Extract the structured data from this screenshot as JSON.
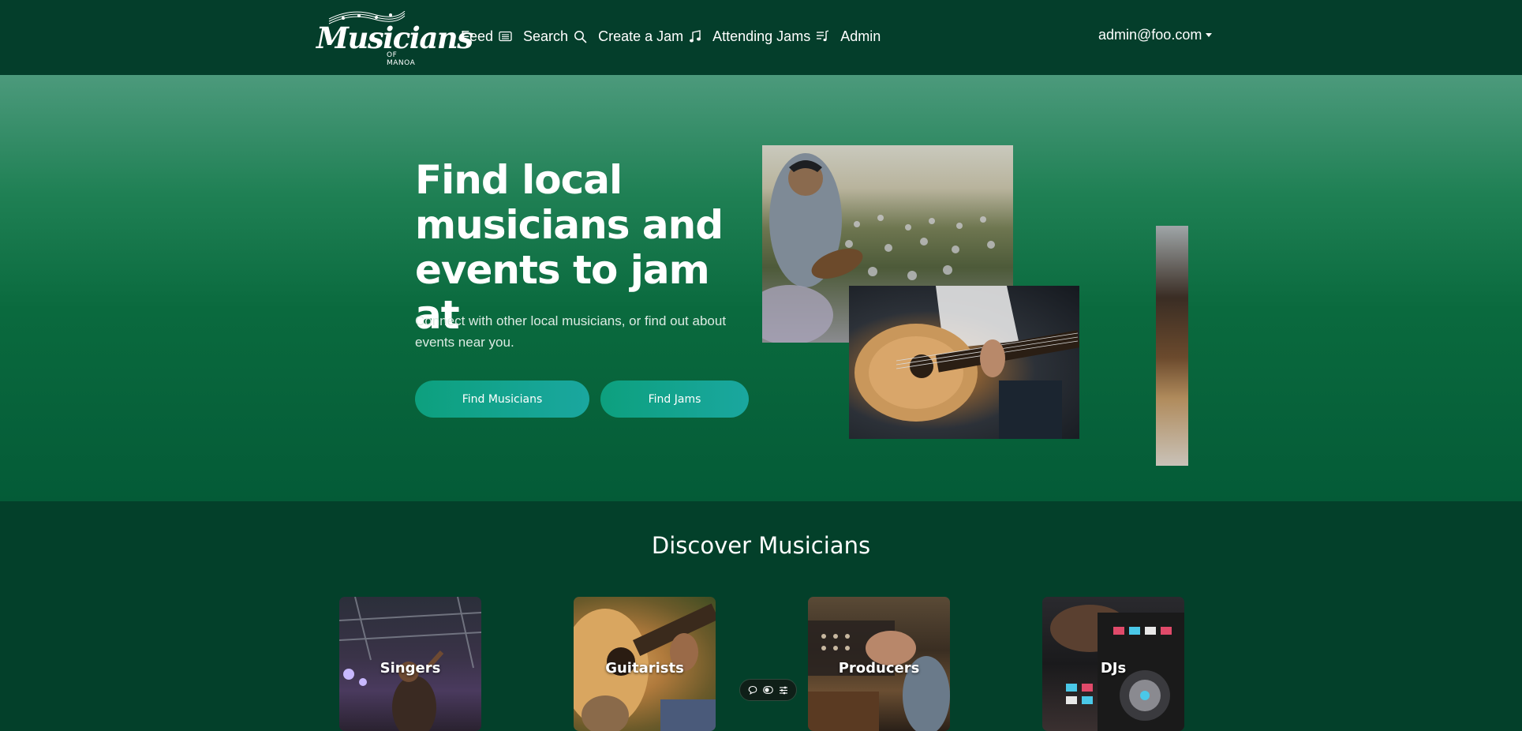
{
  "app": {
    "logo_text": "Musicians",
    "logo_subtext": "OF MANOA"
  },
  "nav": {
    "items": [
      {
        "label": "Feed",
        "icon": "feed-icon"
      },
      {
        "label": "Search",
        "icon": "search-icon"
      },
      {
        "label": "Create a Jam",
        "icon": "music-note-icon"
      },
      {
        "label": "Attending Jams",
        "icon": "playlist-icon"
      },
      {
        "label": "Admin",
        "icon": ""
      }
    ],
    "user_email": "admin@foo.com"
  },
  "hero": {
    "title": "Find local musicians and events to jam at",
    "subtitle": "Connect with other local musicians, or find out about events near you.",
    "buttons": {
      "find_musicians": "Find Musicians",
      "find_jams": "Find Jams"
    }
  },
  "discover": {
    "title": "Discover Musicians",
    "cards": [
      {
        "label": "Singers"
      },
      {
        "label": "Guitarists"
      },
      {
        "label": "Producers"
      },
      {
        "label": "DJs"
      }
    ]
  },
  "floating_toolbar": {
    "icons": [
      "chat-bubble-icon",
      "toggle-icon",
      "sliders-icon"
    ]
  },
  "colors": {
    "navbar_bg": "#043e2b",
    "page_bg": "#03402a",
    "button_gradient_start": "#0da07e",
    "button_gradient_end": "#1aa79f"
  }
}
